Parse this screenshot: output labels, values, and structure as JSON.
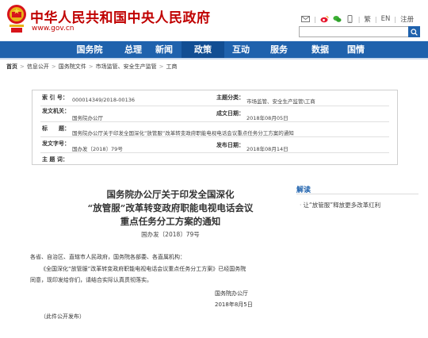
{
  "header": {
    "title": "中华人民共和国中央人民政府",
    "url": "www.gov.cn",
    "links": [
      "繁",
      "EN",
      "注册"
    ],
    "icons": [
      "mail-icon",
      "weibo-icon",
      "wechat-icon",
      "mobile-icon"
    ]
  },
  "nav": {
    "items": [
      "国务院",
      "总理",
      "新闻",
      "政策",
      "互动",
      "服务",
      "数据",
      "国情"
    ],
    "active": "政策"
  },
  "breadcrumb": [
    "首页",
    "信息公开",
    "国务院文件",
    "市场监管、安全生产监管",
    "工商"
  ],
  "info": {
    "index_label": "索 引 号：",
    "index_value": "000014349/2018-00136",
    "topic_label": "主题分类：",
    "topic_value": "市场监管、安全生产监管\\工商",
    "issuer_label": "发文机关：",
    "issuer_value": "国务院办公厅",
    "written_label": "成文日期：",
    "written_value": "2018年08月05日",
    "title_label": "标　　题：",
    "title_value": "国务院办公厅关于印发全国深化“放管服”改革转变政府职能电视电话会议重点任务分工方案的通知",
    "number_label": "发文字号：",
    "number_value": "国办发〔2018〕79号",
    "publish_label": "发布日期：",
    "publish_value": "2018年08月14日",
    "keywords_label": "主 题 词："
  },
  "document": {
    "title_lines": [
      "国务院办公厅关于印发全国深化",
      "“放管服”改革转变政府职能电视电话会议",
      "重点任务分工方案的通知"
    ],
    "doc_number": "国办发〔2018〕79号",
    "salutation": "各省、自治区、直辖市人民政府，国务院各部委、各直属机构：",
    "body_line1": "《全国深化“放管服”改革转变政府职能电视电话会议重点任务分工方案》已经国务院",
    "body_line2": "同意，现印发给你们，请结合实际认真贯彻落实。",
    "signer": "国务院办公厅",
    "date": "2018年8月5日",
    "note": "（此件公开发布）"
  },
  "sidebar": {
    "heading": "解读",
    "links": [
      "让“放管服”释放更多改革红利"
    ]
  },
  "colors": {
    "brand_red": "#c00000",
    "nav_blue": "#1f62ad",
    "nav_active": "#124e93"
  }
}
